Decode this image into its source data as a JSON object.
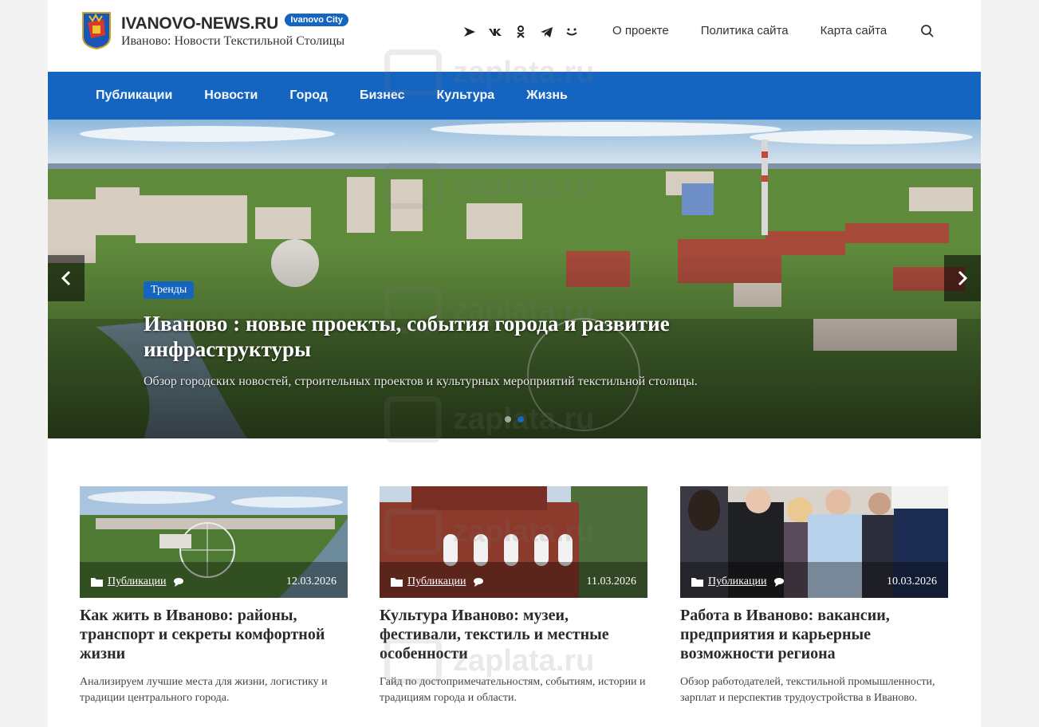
{
  "site": {
    "name": "IVANOVO-NEWS.RU",
    "badge": "Ivanovo City",
    "tagline": "Иваново: Новости Текстильной Столицы"
  },
  "socials": [
    "zen-icon",
    "vk-icon",
    "ok-icon",
    "telegram-icon",
    "smile-icon"
  ],
  "top_nav": [
    "О проекте",
    "Политика сайта",
    "Карта сайта"
  ],
  "main_nav": [
    "Публикации",
    "Новости",
    "Город",
    "Бизнес",
    "Культура",
    "Жизнь"
  ],
  "hero": {
    "category": "Тренды",
    "title": "Иваново : новые проекты, события города и развитие инфраструктуры",
    "subtitle": "Обзор городских новостей, строительных проектов и культурных мероприятий текстильной столицы.",
    "slide_count": 2,
    "active_slide": 1
  },
  "cards": [
    {
      "category": "Публикации",
      "date": "12.03.2026",
      "title": "Как жить в Иваново: районы, транспорт и секреты комфортной жизни",
      "desc": "Анализируем лучшие места для жизни, логистику и традиции центрального города."
    },
    {
      "category": "Публикации",
      "date": "11.03.2026",
      "title": "Культура Иваново: музеи, фестивали, текстиль и местные особенности",
      "desc": "Гайд по достопримечательностям, событиям, истории и традициям города и области."
    },
    {
      "category": "Публикации",
      "date": "10.03.2026",
      "title": "Работа в Иваново: вакансии, предприятия и карьерные возможности региона",
      "desc": "Обзор работодателей, текстильной промышленности, зарплат и перспектив трудоустройства в Иваново."
    }
  ],
  "watermark": "zaplata.ru",
  "colors": {
    "accent": "#1565c0"
  }
}
